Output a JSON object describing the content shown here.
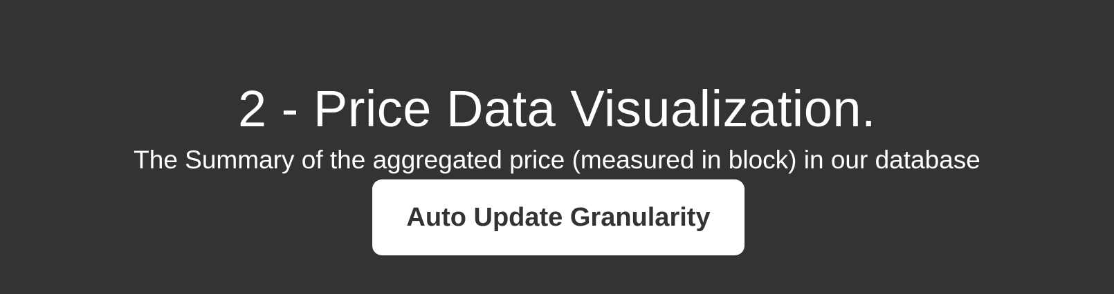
{
  "section": {
    "title": "2 - Price Data Visualization.",
    "subtitle": "The Summary of the aggregated price (measured in block) in our database",
    "button_label": "Auto Update Granularity"
  },
  "colors": {
    "background": "#333333",
    "text": "#ffffff",
    "button_background": "#ffffff",
    "button_text": "#333333"
  }
}
